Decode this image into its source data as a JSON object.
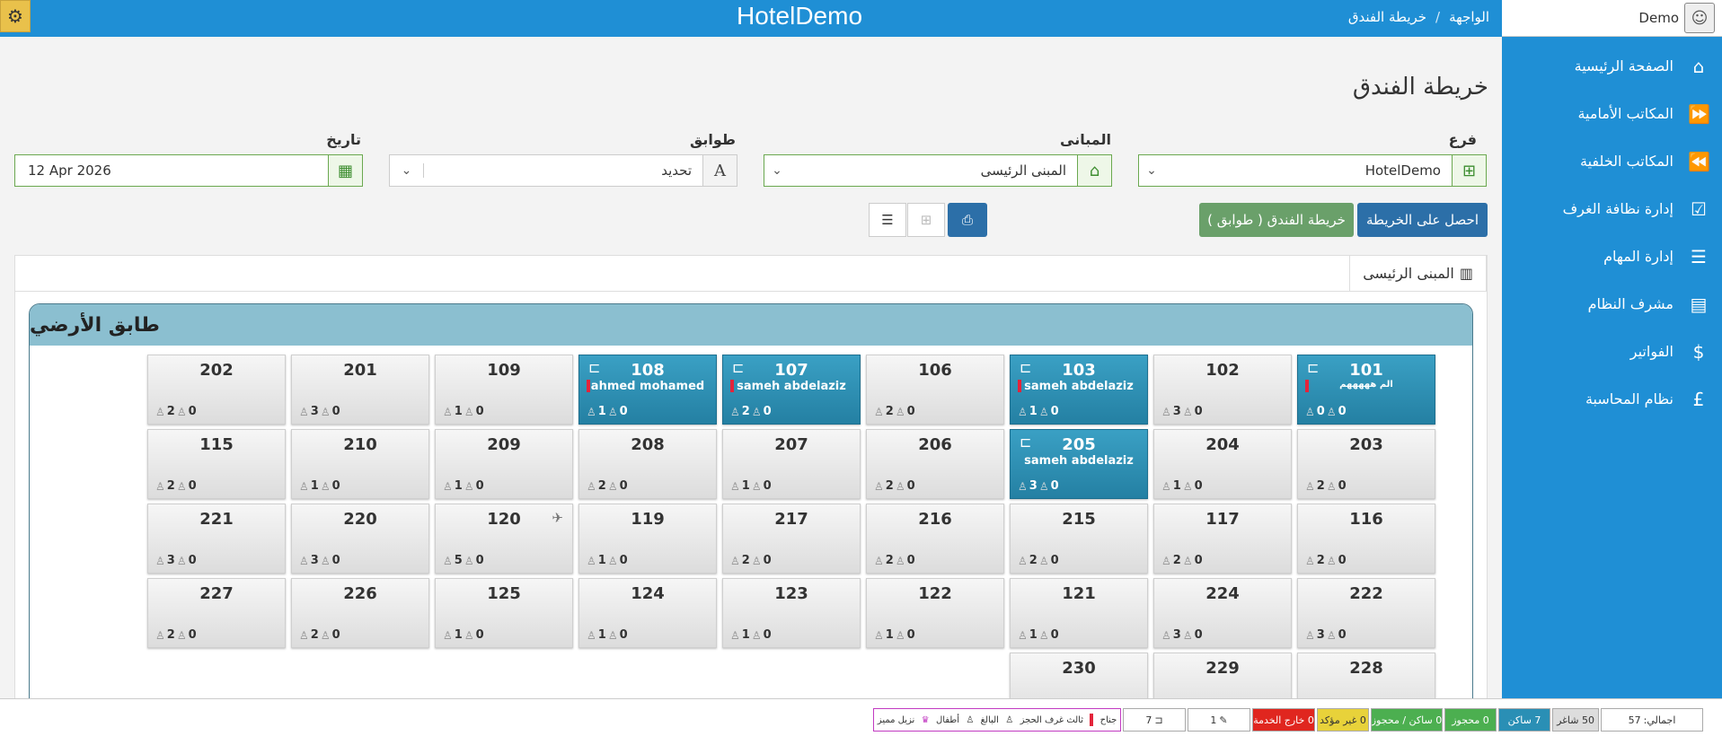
{
  "app": {
    "title": "HotelDemo"
  },
  "breadcrumb": {
    "home": "الواجهة",
    "separator": "/",
    "current": "خريطة الفندق"
  },
  "user": {
    "name": "Demo"
  },
  "sidebar": {
    "items": [
      {
        "label": "الصفحة الرئيسية",
        "icon": "home-icon",
        "glyph": "⌂"
      },
      {
        "label": "المكاتب الأمامية",
        "icon": "forward-icon",
        "glyph": "⏩"
      },
      {
        "label": "المكاتب الخلفية",
        "icon": "backward-icon",
        "glyph": "⏪"
      },
      {
        "label": "إدارة نظافة الغرف",
        "icon": "checkbox-icon",
        "glyph": "☑"
      },
      {
        "label": "إدارة المهام",
        "icon": "tasks-icon",
        "glyph": "☰"
      },
      {
        "label": "مشرف النظام",
        "icon": "monitor-icon",
        "glyph": "▤"
      },
      {
        "label": "الفواتير",
        "icon": "dollar-icon",
        "glyph": "$"
      },
      {
        "label": "نظام المحاسبة",
        "icon": "pound-icon",
        "glyph": "£"
      }
    ]
  },
  "page": {
    "title": "خريطة الفندق"
  },
  "filters": {
    "branch_label": "فرع",
    "branch_value": "HotelDemo",
    "building_label": "المبانى",
    "building_value": "المبنى الرئيسى",
    "floors_label": "طوابق",
    "floors_value": "تحديد",
    "date_label": "تاريخ",
    "date_value": "12 Apr 2026"
  },
  "buttons": {
    "get_map": "احصل على الخريطة",
    "map_floors": "خريطة الفندق ( طوابق )"
  },
  "tabs": [
    {
      "label": "المبنى الرئيسى"
    }
  ],
  "floor": {
    "title": "طابق الأرضي"
  },
  "rooms": [
    {
      "number": "202",
      "adults": "2",
      "kids": "0"
    },
    {
      "number": "201",
      "adults": "3",
      "kids": "0"
    },
    {
      "number": "109",
      "adults": "1",
      "kids": "0"
    },
    {
      "number": "108",
      "adults": "1",
      "kids": "0",
      "guest": "ahmed mohamed",
      "occupied": true
    },
    {
      "number": "107",
      "adults": "2",
      "kids": "0",
      "guest": "sameh abdelaziz",
      "occupied": true
    },
    {
      "number": "106",
      "adults": "2",
      "kids": "0"
    },
    {
      "number": "103",
      "adults": "1",
      "kids": "0",
      "guest": "sameh abdelaziz",
      "occupied": true
    },
    {
      "number": "102",
      "adults": "3",
      "kids": "0"
    },
    {
      "number": "101",
      "adults": "0",
      "kids": "0",
      "guest": "الم هههههم",
      "occupied": true
    },
    {
      "number": "115",
      "adults": "2",
      "kids": "0"
    },
    {
      "number": "210",
      "adults": "1",
      "kids": "0"
    },
    {
      "number": "209",
      "adults": "1",
      "kids": "0"
    },
    {
      "number": "208",
      "adults": "2",
      "kids": "0"
    },
    {
      "number": "207",
      "adults": "1",
      "kids": "0"
    },
    {
      "number": "206",
      "adults": "2",
      "kids": "0"
    },
    {
      "number": "205",
      "adults": "3",
      "kids": "0",
      "guest": "sameh abdelaziz",
      "occupied": true
    },
    {
      "number": "204",
      "adults": "1",
      "kids": "0"
    },
    {
      "number": "203",
      "adults": "2",
      "kids": "0"
    },
    {
      "number": "221",
      "adults": "3",
      "kids": "0"
    },
    {
      "number": "220",
      "adults": "3",
      "kids": "0"
    },
    {
      "number": "120",
      "adults": "5",
      "kids": "0"
    },
    {
      "number": "119",
      "adults": "1",
      "kids": "0"
    },
    {
      "number": "217",
      "adults": "2",
      "kids": "0"
    },
    {
      "number": "216",
      "adults": "2",
      "kids": "0"
    },
    {
      "number": "215",
      "adults": "2",
      "kids": "0"
    },
    {
      "number": "117",
      "adults": "2",
      "kids": "0"
    },
    {
      "number": "116",
      "adults": "2",
      "kids": "0"
    },
    {
      "number": "227",
      "adults": "2",
      "kids": "0"
    },
    {
      "number": "226",
      "adults": "2",
      "kids": "0"
    },
    {
      "number": "125",
      "adults": "1",
      "kids": "0"
    },
    {
      "number": "124",
      "adults": "1",
      "kids": "0"
    },
    {
      "number": "123",
      "adults": "1",
      "kids": "0"
    },
    {
      "number": "122",
      "adults": "1",
      "kids": "0"
    },
    {
      "number": "121",
      "adults": "1",
      "kids": "0"
    },
    {
      "number": "224",
      "adults": "3",
      "kids": "0"
    },
    {
      "number": "222",
      "adults": "3",
      "kids": "0"
    },
    {
      "number": "230"
    },
    {
      "number": "229"
    },
    {
      "number": "228"
    }
  ],
  "footer": {
    "total_label": "اجمالي:",
    "total_value": "57",
    "vacant": "50 شاغر",
    "occupied": "7 ساكن",
    "reserved": "0 محجوز",
    "occupied_reserved": "0 ساكن / محجوز",
    "unconfirmed": "0 غير مؤكد",
    "out_of_service": "0 خارج الخدمة",
    "count_a": "1",
    "count_b": "7",
    "legend_suite": "جناح",
    "legend_third": "ثالث غرف الحجز",
    "legend_adult": "البالغ",
    "legend_kids": "أطفال",
    "legend_vip": "نزيل مميز"
  },
  "colors": {
    "primary": "#1f8fd5",
    "occupied": "#2a8fb5",
    "reserved": "#4caf50",
    "unconfirmed": "#e8d23a",
    "out_of_service": "#e0261f"
  }
}
